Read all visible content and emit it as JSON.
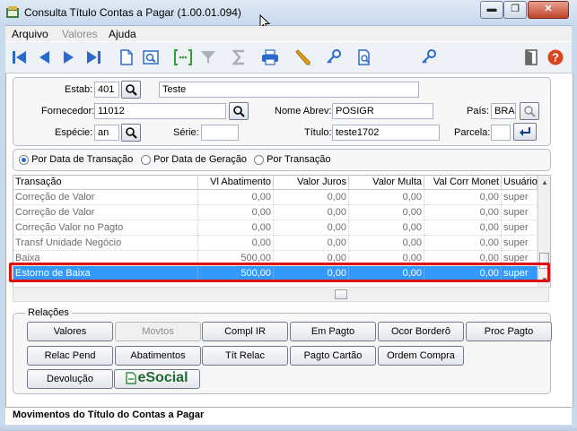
{
  "window": {
    "title": "Consulta Título Contas a Pagar (1.00.01.094)",
    "min_glyph": "▬",
    "max_glyph": "❐",
    "close_glyph": "✕"
  },
  "menu": [
    "Arquivo",
    "Valores",
    "Ajuda"
  ],
  "toolbar_icons": [
    "first-icon",
    "previous-icon",
    "next-icon",
    "last-icon",
    "document-icon",
    "zoom-view-icon",
    "bracket-select-icon",
    "filter-icon",
    "sum-icon",
    "print-icon",
    "pencil-icon",
    "key-icon",
    "document-search-icon",
    "key-search-icon",
    "exit-door-icon",
    "help-icon"
  ],
  "form": {
    "estab_label": "Estab:",
    "estab_value": "401",
    "estab_name": "Teste",
    "fornecedor_label": "Fornecedor:",
    "fornecedor_value": "11012",
    "nome_abrev_label": "Nome Abrev:",
    "nome_abrev_value": "POSIGR",
    "pais_label": "País:",
    "pais_value": "BRA",
    "especie_label": "Espécie:",
    "especie_value": "an",
    "serie_label": "Série:",
    "serie_value": "",
    "titulo_label": "Título:",
    "titulo_value": "teste1702",
    "parcela_label": "Parcela:",
    "parcela_value": ""
  },
  "radios": [
    {
      "label": "Por Data de Transação",
      "selected": true
    },
    {
      "label": "Por Data de Geração",
      "selected": false
    },
    {
      "label": "Por Transação",
      "selected": false
    }
  ],
  "table": {
    "headers": [
      "Transação",
      "Vl Abatimento",
      "Valor Juros",
      "Valor Multa",
      "Val Corr Monet",
      "Usuário"
    ],
    "rows": [
      [
        "Correção de Valor",
        "0,00",
        "0,00",
        "0,00",
        "0,00",
        "super"
      ],
      [
        "Correção de Valor",
        "0,00",
        "0,00",
        "0,00",
        "0,00",
        "super"
      ],
      [
        "Correção Valor no Pagto",
        "0,00",
        "0,00",
        "0,00",
        "0,00",
        "super"
      ],
      [
        "Transf Unidade Negócio",
        "0,00",
        "0,00",
        "0,00",
        "0,00",
        "super"
      ],
      [
        "Baixa",
        "500,00",
        "0,00",
        "0,00",
        "0,00",
        "super"
      ],
      [
        "Estorno de Baixa",
        "500,00",
        "0,00",
        "0,00",
        "0,00",
        "super"
      ]
    ],
    "selected_row": 5
  },
  "relacoes": {
    "title": "Relações",
    "buttons_row1": [
      "Valores",
      "Movtos",
      "Compl IR",
      "Em Pagto",
      "Ocor Borderô",
      "Proc Pagto"
    ],
    "buttons_row2": [
      "Relac Pend",
      "Abatimentos",
      "Tít  Relac",
      "Pagto Cartão",
      "Ordem Compra"
    ],
    "buttons_row3": [
      "Devolução"
    ],
    "esocial_label": "eSocial",
    "disabled": [
      "Movtos"
    ]
  },
  "status": "Movimentos do Título do Contas a Pagar",
  "colors": {
    "selection": "#3399ff",
    "highlight": "#e01010",
    "toolbar_blue": "#2a6bc9"
  }
}
